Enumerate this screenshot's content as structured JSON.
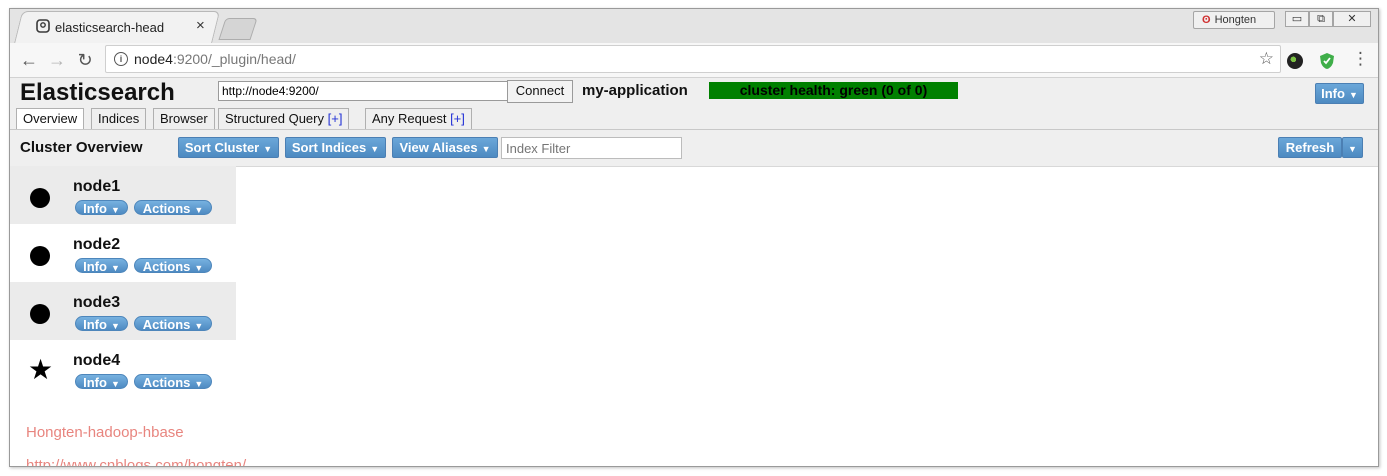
{
  "browser": {
    "tab_title": "elasticsearch-head",
    "tab_close": "×",
    "user_name": "Hongten",
    "url_host": "node4",
    "url_path": ":9200/_plugin/head/",
    "win_min": "▭",
    "win_restore": "⧉",
    "win_close": "✕",
    "back": "←",
    "forward": "→",
    "reload": "↻",
    "star": "☆",
    "menu": "⋮"
  },
  "header": {
    "title": "Elasticsearch",
    "connection_url": "http://node4:9200/",
    "connect_label": "Connect",
    "cluster_name": "my-application",
    "cluster_health": "cluster health: green (0 of 0)",
    "info_label": "Info"
  },
  "tabs": [
    {
      "label": "Overview"
    },
    {
      "label": "Indices"
    },
    {
      "label": "Browser"
    },
    {
      "label": "Structured Query",
      "suffix": "[+]"
    },
    {
      "label": "Any Request",
      "suffix": "[+]"
    }
  ],
  "overview": {
    "title": "Cluster Overview",
    "sort_cluster": "Sort Cluster",
    "sort_indices": "Sort Indices",
    "view_aliases": "View Aliases",
    "index_filter_placeholder": "Index Filter",
    "refresh": "Refresh"
  },
  "nodes": [
    {
      "name": "node1",
      "info": "Info",
      "actions": "Actions",
      "symbol": "circle"
    },
    {
      "name": "node2",
      "info": "Info",
      "actions": "Actions",
      "symbol": "circle"
    },
    {
      "name": "node3",
      "info": "Info",
      "actions": "Actions",
      "symbol": "circle"
    },
    {
      "name": "node4",
      "info": "Info",
      "actions": "Actions",
      "symbol": "star"
    }
  ],
  "watermark": {
    "line1": "Hongten-hadoop-hbase",
    "line2": "http://www.cnblogs.com/hongten/"
  },
  "colors": {
    "health_green": "#008000",
    "button_blue": "#5b97cc"
  }
}
